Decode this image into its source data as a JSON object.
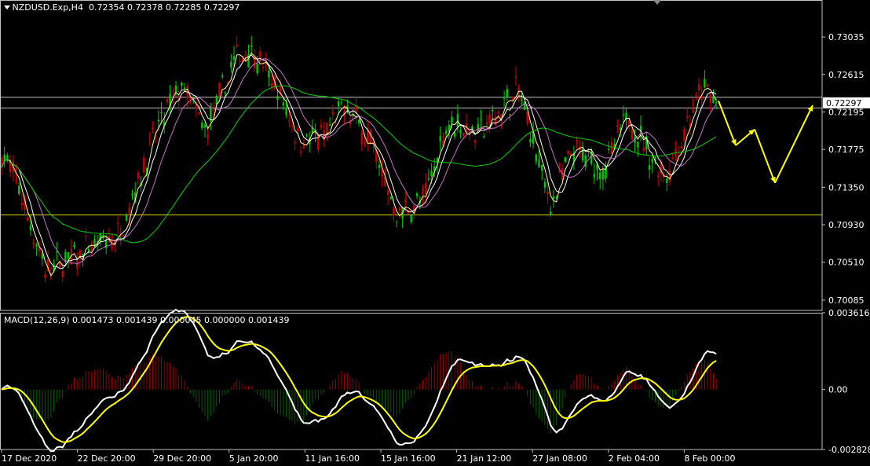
{
  "window": {
    "title": "NZDUSD.Exp,H4",
    "ohlc": "0.72354 0.72378 0.72285 0.72297"
  },
  "price_axis": {
    "ticks": [
      "0.73035",
      "0.72615",
      "0.72195",
      "0.71775",
      "0.71350",
      "0.70930",
      "0.70510",
      "0.70085"
    ],
    "current_price": "0.72297"
  },
  "time_axis": {
    "labels": [
      "17 Dec 2020",
      "22 Dec 20:00",
      "29 Dec 20:00",
      "5 Jan 20:00",
      "11 Jan 16:00",
      "15 Jan 16:00",
      "21 Jan 12:00",
      "27 Jan 08:00",
      "2 Feb 04:00",
      "8 Feb 00:00"
    ]
  },
  "macd": {
    "title": "MACD(12,26,9) 0.001473 0.001439 0.000045 0.000000 0.001439",
    "ticks": [
      "0.003616",
      "0.00",
      "-0.002828"
    ]
  },
  "colors": {
    "background": "#000000",
    "bull": "#00c800",
    "bear": "#c80000",
    "ma_fast": "#ffff99",
    "ma_white": "#ffffff",
    "ma_violet": "#c872c8",
    "ma_slow": "#00d000",
    "level_line": "#d4d400",
    "grid": "#c0c0c0",
    "arrow": "#ffff00",
    "macd_line": "#ffffff",
    "signal_line": "#ffff00",
    "hist_pos": "#a00000",
    "hist_neg": "#006000"
  },
  "chart_data": {
    "type": "candlestick",
    "symbol": "NZDUSD.Exp",
    "timeframe": "H4",
    "price_range": [
      0.6997,
      0.7345
    ],
    "levels": [
      0.7236,
      0.7224,
      0.7104
    ],
    "forecast_path": [
      {
        "t": 0,
        "p": 0.7232
      },
      {
        "t": 22,
        "p": 0.7182
      },
      {
        "t": 46,
        "p": 0.72
      },
      {
        "t": 72,
        "p": 0.714
      },
      {
        "t": 120,
        "p": 0.7227
      }
    ],
    "macd_range": [
      -0.002828,
      0.003616
    ]
  }
}
